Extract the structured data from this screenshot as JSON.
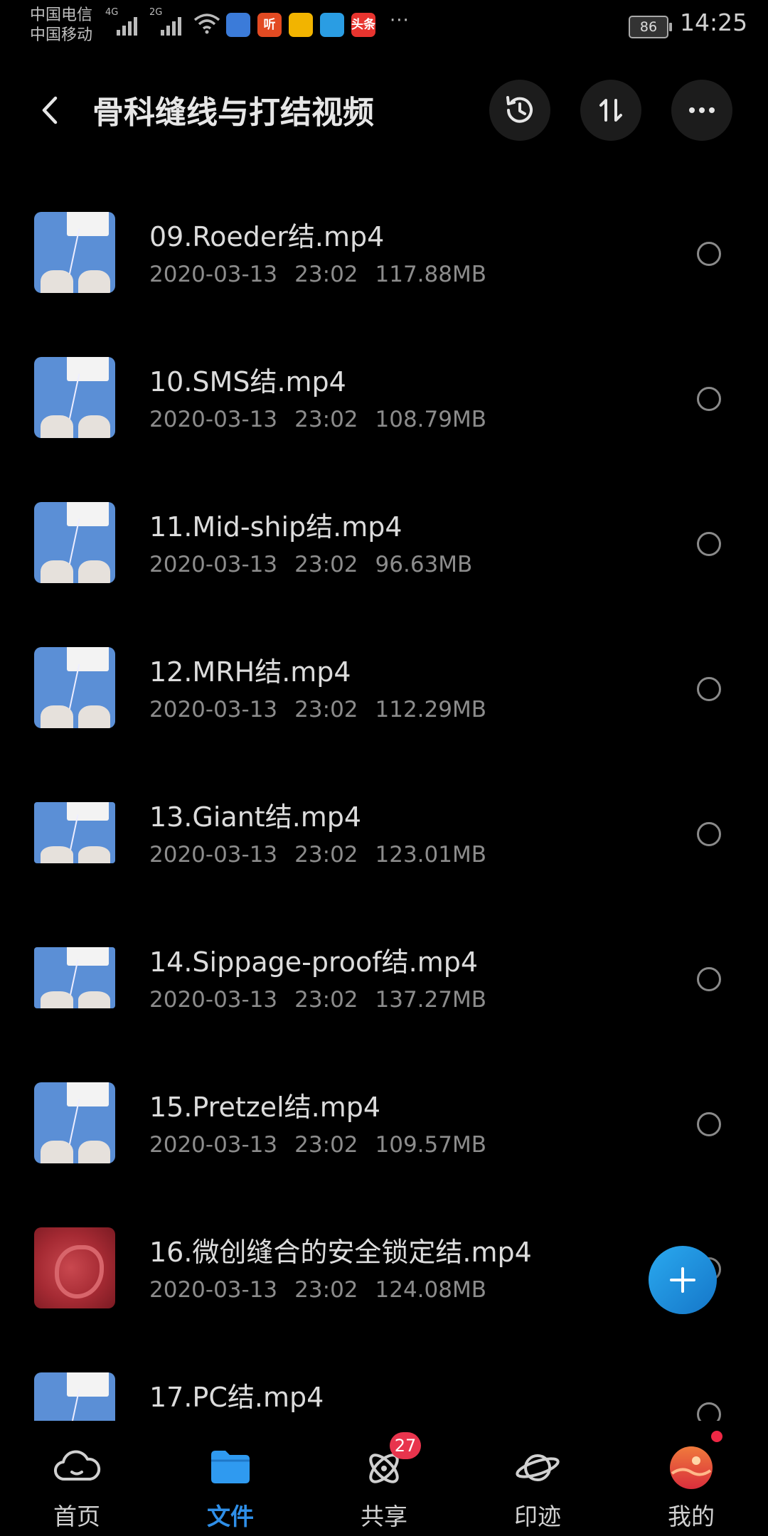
{
  "status_bar": {
    "carrier1": "中国电信",
    "carrier2": "中国移动",
    "net1": "4G",
    "net2": "2G",
    "app_icons": [
      {
        "name": "colorful-app-icon",
        "label": "",
        "color": "#3b7bd9"
      },
      {
        "name": "ting-app-icon",
        "label": "听",
        "color": "#e24a22"
      },
      {
        "name": "yellow-app-icon",
        "label": "",
        "color": "#f2b400"
      },
      {
        "name": "telegram-app-icon",
        "label": "",
        "color": "#2a9de3"
      },
      {
        "name": "toutiao-app-icon",
        "label": "头条",
        "color": "#e8342f"
      }
    ],
    "more": "···",
    "battery": "86",
    "time": "14:25"
  },
  "header": {
    "title": "骨科缝线与打结视频"
  },
  "files": [
    {
      "name": "09.Roeder结.mp4",
      "date": "2020-03-13",
      "time": "23:02",
      "size": "117.88MB",
      "thumb": "blue"
    },
    {
      "name": "10.SMS结.mp4",
      "date": "2020-03-13",
      "time": "23:02",
      "size": "108.79MB",
      "thumb": "blue"
    },
    {
      "name": "11.Mid-ship结.mp4",
      "date": "2020-03-13",
      "time": "23:02",
      "size": "96.63MB",
      "thumb": "blue"
    },
    {
      "name": "12.MRH结.mp4",
      "date": "2020-03-13",
      "time": "23:02",
      "size": "112.29MB",
      "thumb": "blue"
    },
    {
      "name": "13.Giant结.mp4",
      "date": "2020-03-13",
      "time": "23:02",
      "size": "123.01MB",
      "thumb": "wide"
    },
    {
      "name": "14.Sippage-proof结.mp4",
      "date": "2020-03-13",
      "time": "23:02",
      "size": "137.27MB",
      "thumb": "wide"
    },
    {
      "name": "15.Pretzel结.mp4",
      "date": "2020-03-13",
      "time": "23:02",
      "size": "109.57MB",
      "thumb": "blue"
    },
    {
      "name": "16.微创缝合的安全锁定结.mp4",
      "date": "2020-03-13",
      "time": "23:02",
      "size": "124.08MB",
      "thumb": "red"
    },
    {
      "name": "17.PC结.mp4",
      "date": "",
      "time": "",
      "size": "",
      "thumb": "blue"
    }
  ],
  "tabs": [
    {
      "label": "首页",
      "icon": "cloud-icon",
      "active": false
    },
    {
      "label": "文件",
      "icon": "folder-icon",
      "active": true
    },
    {
      "label": "共享",
      "icon": "atom-icon",
      "active": false,
      "badge": "27"
    },
    {
      "label": "印迹",
      "icon": "planet-icon",
      "active": false
    },
    {
      "label": "我的",
      "icon": "avatar-icon",
      "active": false,
      "dot": true
    }
  ],
  "colors": {
    "accent": "#2f8fe8",
    "background": "#000000",
    "badge": "#e8344d"
  }
}
